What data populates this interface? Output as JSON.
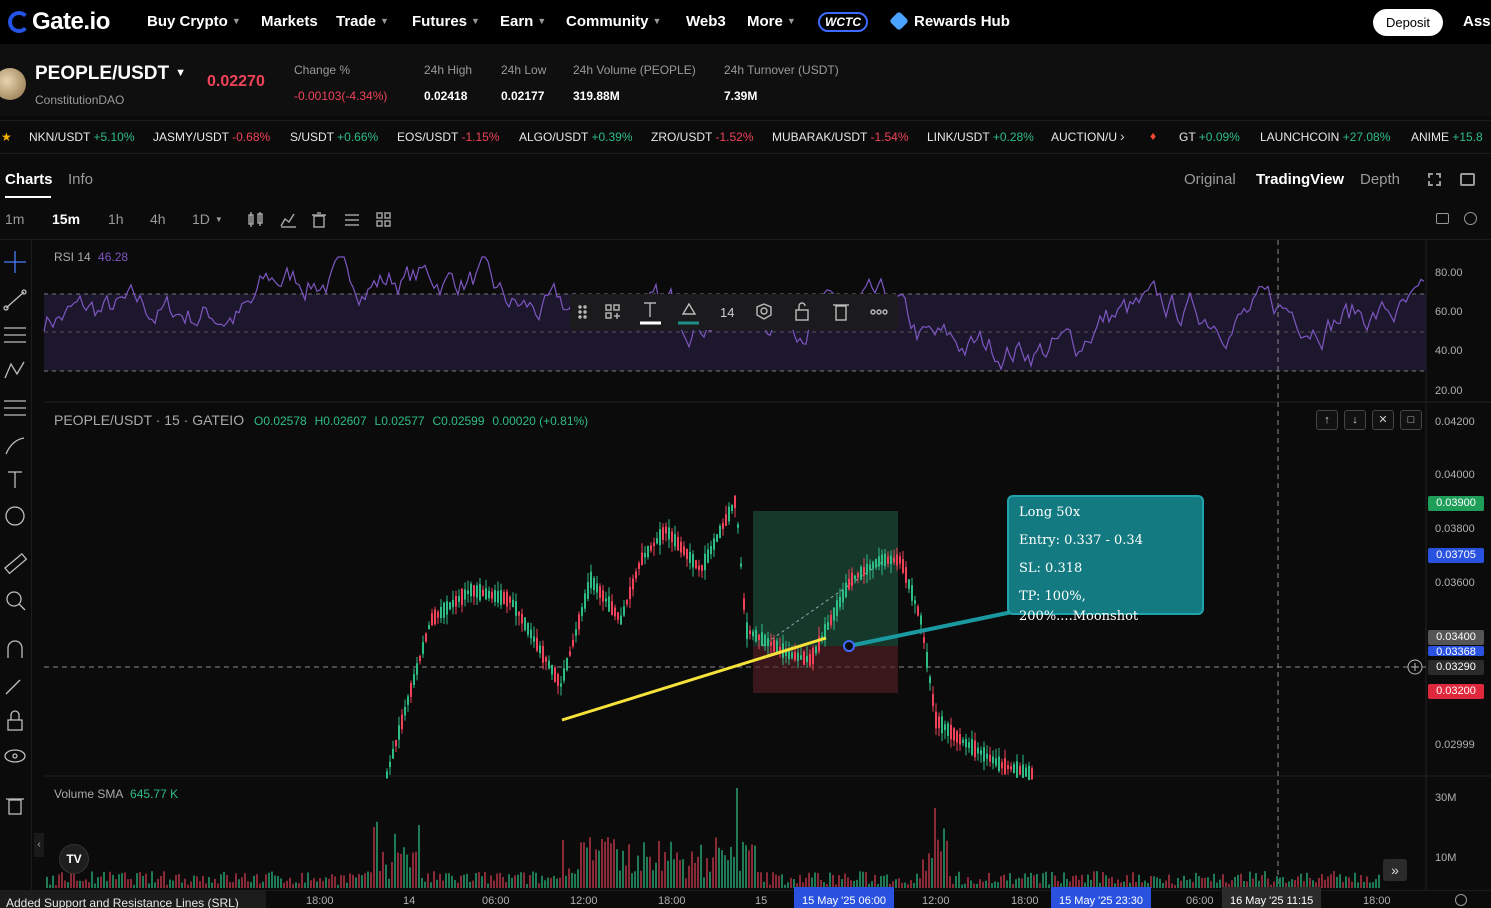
{
  "nav": {
    "logo": "Gate.io",
    "items": [
      {
        "label": "Buy Crypto",
        "caret": true
      },
      {
        "label": "Markets",
        "caret": false
      },
      {
        "label": "Trade",
        "caret": true
      },
      {
        "label": "Futures",
        "caret": true
      },
      {
        "label": "Earn",
        "caret": true
      },
      {
        "label": "Community",
        "caret": true
      },
      {
        "label": "Web3",
        "caret": false
      },
      {
        "label": "More",
        "caret": true
      }
    ],
    "wctc": "WCTC",
    "rewards": "Rewards Hub",
    "deposit": "Deposit",
    "assets": "Asse"
  },
  "pair": {
    "symbol": "PEOPLE/USDT",
    "name": "ConstitutionDAO",
    "price": "0.02270",
    "stats": [
      {
        "label": "Change %",
        "value": "-0.00103(-4.34%)",
        "color": "#f0435a"
      },
      {
        "label": "24h High",
        "value": "0.02418"
      },
      {
        "label": "24h Low",
        "value": "0.02177"
      },
      {
        "label": "24h Volume (PEOPLE)",
        "value": "319.88M"
      },
      {
        "label": "24h Turnover (USDT)",
        "value": "7.39M"
      }
    ]
  },
  "ticker_strip": [
    {
      "pair": "NKN/USDT",
      "change": "+5.10%",
      "dir": "up"
    },
    {
      "pair": "JASMY/USDT",
      "change": "-0.68%",
      "dir": "dn"
    },
    {
      "pair": "S/USDT",
      "change": "+0.66%",
      "dir": "up"
    },
    {
      "pair": "EOS/USDT",
      "change": "-1.15%",
      "dir": "dn"
    },
    {
      "pair": "ALGO/USDT",
      "change": "+0.39%",
      "dir": "up"
    },
    {
      "pair": "ZRO/USDT",
      "change": "-1.52%",
      "dir": "dn"
    },
    {
      "pair": "MUBARAK/USDT",
      "change": "-1.54%",
      "dir": "dn"
    },
    {
      "pair": "LINK/USDT",
      "change": "+0.28%",
      "dir": "up"
    },
    {
      "pair": "AUCTION/U",
      "change": "",
      "dir": "up"
    }
  ],
  "hot_strip": [
    {
      "pair": "GT",
      "change": "+0.09%",
      "dir": "up"
    },
    {
      "pair": "LAUNCHCOIN",
      "change": "+27.08%",
      "dir": "up"
    },
    {
      "pair": "ANIME",
      "change": "+15.8",
      "dir": "up"
    }
  ],
  "tabs": {
    "charts": "Charts",
    "info": "Info",
    "original": "Original",
    "tradingview": "TradingView",
    "depth": "Depth"
  },
  "intervals": [
    "1m",
    "15m",
    "1h",
    "4h",
    "1D"
  ],
  "rsi": {
    "label": "RSI 14",
    "value": "46.28",
    "ticks": [
      "80.00",
      "60.00",
      "40.00",
      "20.00"
    ]
  },
  "main": {
    "title": "PEOPLE/USDT · 15 · GATEIO",
    "o": "O0.02578",
    "h": "H0.02607",
    "l": "L0.02577",
    "c": "C0.02599",
    "chg": "0.00020 (+0.81%)",
    "ticks": [
      "0.04200",
      "0.04000",
      "0.03800",
      "0.03600",
      "0.02999"
    ],
    "tags": [
      {
        "value": "0.03900",
        "color": "#1f9e5a"
      },
      {
        "value": "0.03705",
        "color": "#2a52e0"
      },
      {
        "value": "0.03400",
        "color": "#555555"
      },
      {
        "value": "0.03368",
        "color": "#2a52e0"
      },
      {
        "value": "0.03290",
        "color": "#2b2b2b"
      },
      {
        "value": "0.03200",
        "color": "#e0283c"
      }
    ]
  },
  "float_toolbar": {
    "size": "14"
  },
  "tooltip": {
    "line1": "Long 50x",
    "line2": "Entry: 0.337 - 0.34",
    "line3": "SL: 0.318",
    "line4": "TP: 100%, 200%....Moonshot"
  },
  "volume": {
    "label": "Volume SMA",
    "value": "645.77 K",
    "ticks": [
      "30M",
      "10M"
    ]
  },
  "time_axis": {
    "labels": [
      "18:00",
      "14",
      "06:00",
      "12:00",
      "18:00",
      "15",
      "12:00",
      "18:00",
      "06:00",
      "18:00"
    ],
    "highlight1": "15 May '25   06:00",
    "highlight2": "15 May '25   23:30",
    "highlight3": "16 May '25   11:15"
  },
  "status": "Added Support and Resistance Lines (SRL)"
}
